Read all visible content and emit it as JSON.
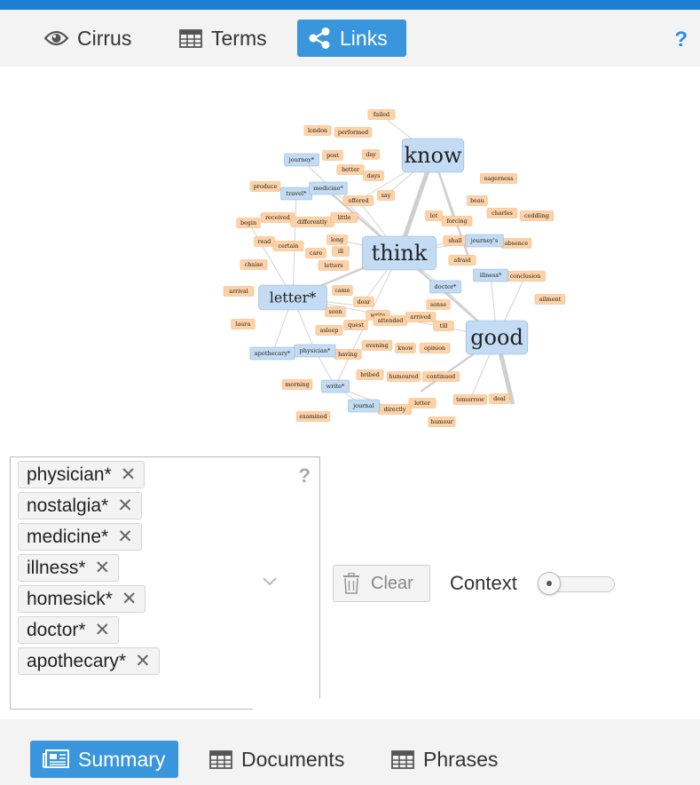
{
  "tabs": {
    "cirrus": "Cirrus",
    "terms": "Terms",
    "links": "Links",
    "help": "?"
  },
  "graph": {
    "key_terms": [
      "know",
      "think",
      "good",
      "letter*",
      "journey*",
      "travel*",
      "medicine*",
      "physician*",
      "apothecary*",
      "write*",
      "journal",
      "doctor*",
      "illness*",
      "journey's"
    ],
    "terms": [
      "failed",
      "london",
      "performed",
      "post",
      "day",
      "better",
      "days",
      "produce",
      "offered",
      "say",
      "eagerness",
      "beau",
      "charles",
      "coddling",
      "begin",
      "received",
      "differently",
      "little",
      "let",
      "forcing",
      "shall",
      "absence",
      "read",
      "certain",
      "long",
      "care",
      "ill",
      "letters",
      "afraid",
      "chaise",
      "conclusion",
      "arrival",
      "came",
      "dear",
      "sense",
      "ailment",
      "soon",
      "write",
      "attended",
      "arrived",
      "laura",
      "asleep",
      "quest",
      "till",
      "evening",
      "know",
      "opinion",
      "having",
      "bribed",
      "humoured",
      "continued",
      "morning",
      "tomorrow",
      "deal",
      "letter",
      "directly",
      "examined",
      "humour"
    ]
  },
  "tags": {
    "items": [
      "physician*",
      "nostalgia*",
      "medicine*",
      "illness*",
      "homesick*",
      "doctor*",
      "apothecary*"
    ],
    "help": "?",
    "remove_glyph": "✕"
  },
  "controls": {
    "clear_label": "Clear",
    "context_label": "Context",
    "context_value": 0
  },
  "bottom_tabs": {
    "summary": "Summary",
    "documents": "Documents",
    "phrases": "Phrases"
  },
  "colors": {
    "accent": "#3a96dc",
    "topbar": "#1e7fd0",
    "term_node": "#fdd2a6",
    "key_node": "#c4dcf3"
  }
}
